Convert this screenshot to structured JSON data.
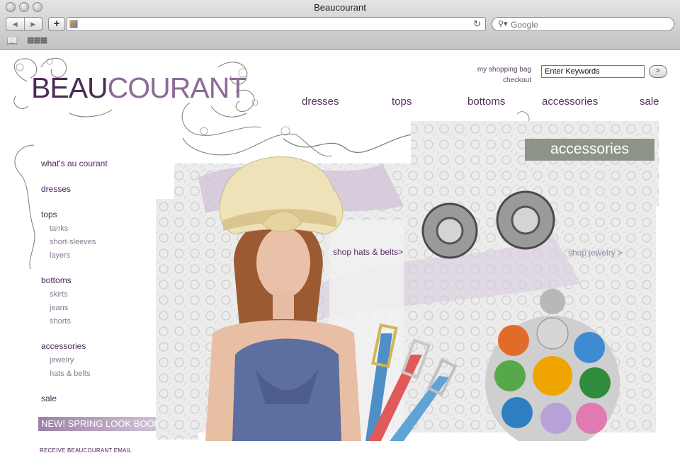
{
  "browser": {
    "window_title": "Beaucourant",
    "address": "",
    "search_placeholder": "Google",
    "back_label": "◀",
    "forward_label": "▶",
    "add_label": "+",
    "reload_label": "↻",
    "bookmarks_icon": "book-icon",
    "topsites_icon": "grid-icon"
  },
  "site": {
    "logo_bold": "BEAU",
    "logo_light": "COURANT",
    "my_shopping_bag": "my shopping bag",
    "checkout": "checkout",
    "search_placeholder": "Enter Keywords",
    "search_value": "Enter Keywords",
    "search_go": ">"
  },
  "main_nav": [
    "dresses",
    "tops",
    "bottoms",
    "accessories",
    "sale"
  ],
  "left_nav": {
    "whats_au_courant": "what's au courant",
    "dresses": "dresses",
    "tops": "tops",
    "tops_sub": [
      "tanks",
      "short-sleeves",
      "layers"
    ],
    "bottoms": "bottoms",
    "bottoms_sub": [
      "skirts",
      "jeans",
      "shorts"
    ],
    "accessories": "accessories",
    "accessories_sub": [
      "jewelry",
      "hats & belts"
    ],
    "sale": "sale"
  },
  "hero": {
    "section_title": "accessories",
    "shop_hats_belts": "shop hats & belts>",
    "shop_jewelry": "shop jewelry >"
  },
  "promo": {
    "spring_look_book": "NEW! SPRING LOOK BOOK",
    "email_label": "RECEIVE BEAUCOURANT EMAIL"
  },
  "colors": {
    "brand_purple": "#4c2b57",
    "banner_gray_green": "#8b9487",
    "spring_banner": "#9b81a6"
  }
}
